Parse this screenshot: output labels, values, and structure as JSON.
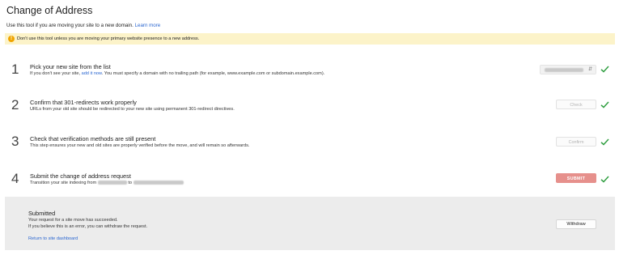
{
  "page": {
    "title": "Change of Address",
    "subtitle": "Use this tool if you are moving your site to a new domain.",
    "learn_more": "Learn more"
  },
  "banner": {
    "icon": "warning-icon",
    "text": "Don't use this tool unless you are moving your primary website presence to a new address."
  },
  "steps": [
    {
      "number": "1",
      "title": "Pick your new site from the list",
      "desc_before": "If you don't see your site, ",
      "desc_link": "add it now",
      "desc_after": ". You must specify a domain with no trailing path (for example, www.example.com or subdomain.example.com).",
      "control": "site-select",
      "status": "check-icon"
    },
    {
      "number": "2",
      "title": "Confirm that 301-redirects work properly",
      "desc": "URLs from your old site should be redirected to your new site using permanent 301-redirect directives.",
      "button_label": "Check",
      "status": "check-icon"
    },
    {
      "number": "3",
      "title": "Check that verification methods are still present",
      "desc": "This step ensures your new and old sites are properly verified before the move, and will remain so afterwards.",
      "button_label": "Confirm",
      "status": "check-icon"
    },
    {
      "number": "4",
      "title": "Submit the change of address request",
      "desc_prefix": "Transition your site indexing from",
      "desc_mid": "to",
      "button_label": "SUBMIT",
      "status": "check-icon"
    }
  ],
  "submitted": {
    "title": "Submitted",
    "line1": "Your request for a site move has succeeded.",
    "line2": "If you believe this is an error, you can withdraw the request.",
    "link": "Return to site dashboard",
    "withdraw_label": "Withdraw"
  },
  "colors": {
    "banner_bg": "#fcf3c9",
    "link": "#2a66d0",
    "check": "#2e9e3f",
    "submit_bg": "#e6908c",
    "submitted_bg": "#ececec"
  }
}
